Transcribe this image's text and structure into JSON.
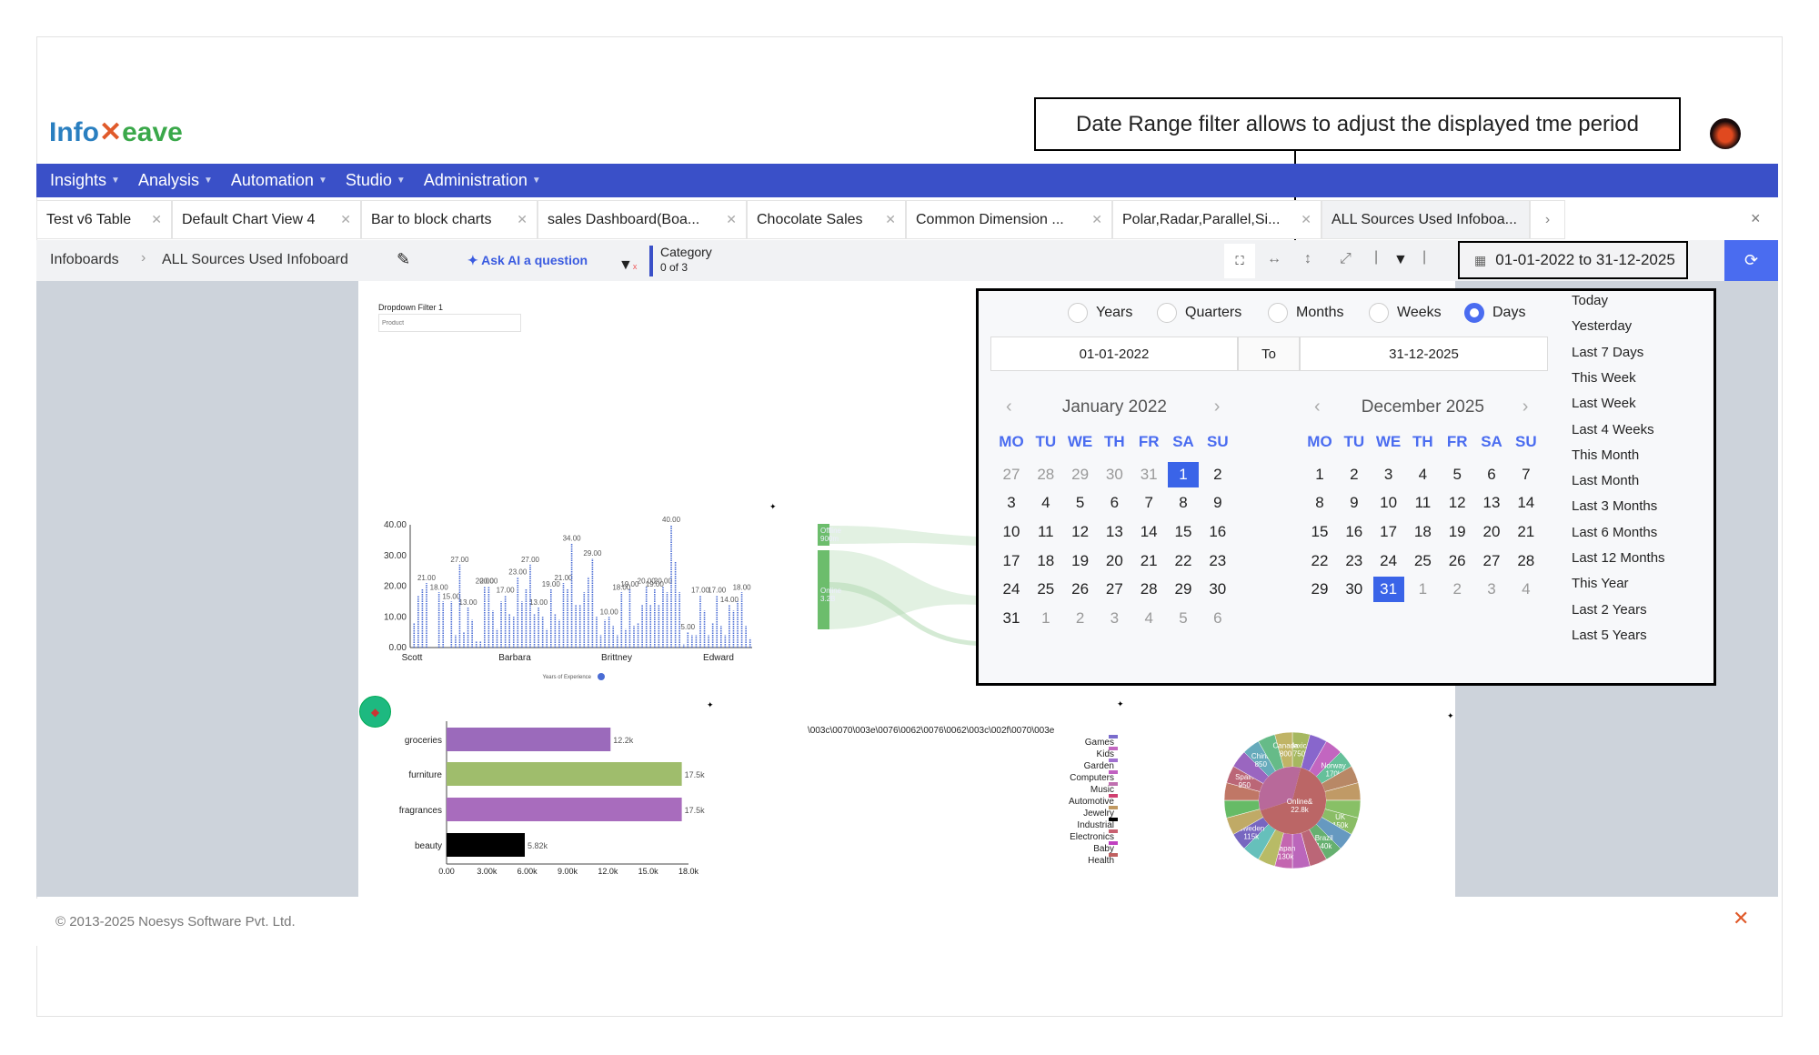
{
  "logo": {
    "part1": "Info",
    "part2": "eave"
  },
  "annotation": "Date Range filter allows to adjust the displayed tme period",
  "nav": [
    {
      "label": "Insights"
    },
    {
      "label": "Analysis"
    },
    {
      "label": "Automation"
    },
    {
      "label": "Studio"
    },
    {
      "label": "Administration"
    }
  ],
  "tabs": [
    {
      "label": "Test v6 Table"
    },
    {
      "label": "Default Chart View 4"
    },
    {
      "label": "Bar to block charts"
    },
    {
      "label": "sales Dashboard(Boa..."
    },
    {
      "label": "Chocolate Sales"
    },
    {
      "label": "Common Dimension ..."
    },
    {
      "label": "Polar,Radar,Parallel,Si..."
    },
    {
      "label": "ALL Sources Used Infoboa..."
    }
  ],
  "breadcrumb": {
    "root": "Infoboards",
    "current": "ALL Sources Used Infoboard"
  },
  "ask_ai": "Ask AI a question",
  "category_filter": {
    "label": "Category",
    "count": "0 of 3"
  },
  "date_range": {
    "value": "01-01-2022 to 31-12-2025"
  },
  "picker": {
    "modes": [
      "Years",
      "Quarters",
      "Months",
      "Weeks",
      "Days"
    ],
    "selected_mode": "Days",
    "from": "01-01-2022",
    "to_label": "To",
    "to": "31-12-2025",
    "weekdays": [
      "MO",
      "TU",
      "WE",
      "TH",
      "FR",
      "SA",
      "SU"
    ],
    "months": [
      {
        "title": "January 2022",
        "selected": 1,
        "weeks": [
          [
            27,
            28,
            29,
            30,
            31,
            1,
            2
          ],
          [
            3,
            4,
            5,
            6,
            7,
            8,
            9
          ],
          [
            10,
            11,
            12,
            13,
            14,
            15,
            16
          ],
          [
            17,
            18,
            19,
            20,
            21,
            22,
            23
          ],
          [
            24,
            25,
            26,
            27,
            28,
            29,
            30
          ],
          [
            31,
            1,
            2,
            3,
            4,
            5,
            6
          ]
        ]
      },
      {
        "title": "December 2025",
        "selected": 31,
        "weeks": [
          [
            1,
            2,
            3,
            4,
            5,
            6,
            7
          ],
          [
            8,
            9,
            10,
            11,
            12,
            13,
            14
          ],
          [
            15,
            16,
            17,
            18,
            19,
            20,
            21
          ],
          [
            22,
            23,
            24,
            25,
            26,
            27,
            28
          ],
          [
            29,
            30,
            31,
            1,
            2,
            3,
            4
          ]
        ]
      }
    ],
    "quick": [
      "Today",
      "Yesterday",
      "Last 7 Days",
      "This Week",
      "Last Week",
      "Last 4 Weeks",
      "This Month",
      "Last Month",
      "Last 3 Months",
      "Last 6 Months",
      "Last 12 Months",
      "This Year",
      "Last 2 Years",
      "Last 5 Years"
    ]
  },
  "dropdown_filter": {
    "label": "Dropdown Filter 1",
    "placeholder": "Product"
  },
  "chart_data": [
    {
      "type": "bar",
      "ylim": [
        0,
        40
      ],
      "yticks": [
        "0.00",
        "10.00",
        "20.00",
        "30.00",
        "40.00"
      ],
      "xticks": [
        "Scott",
        "Barbara",
        "Brittney",
        "Edward"
      ],
      "legend": "Years of Experience",
      "color": "#4a6cd4",
      "values": [
        8,
        17,
        19,
        21,
        0,
        0,
        18,
        15,
        0,
        15,
        4,
        27,
        5,
        13,
        9,
        2,
        2,
        20,
        20,
        12,
        6,
        15,
        17,
        11,
        10,
        23,
        15,
        19,
        27,
        11,
        13,
        10,
        6,
        19,
        11,
        9,
        21,
        19,
        34,
        14,
        14,
        18,
        23,
        29,
        10,
        4,
        9,
        10,
        7,
        4,
        18,
        6,
        19,
        7,
        8,
        14,
        20,
        14,
        19,
        14,
        20,
        18,
        40,
        28,
        18,
        1,
        5,
        4,
        4,
        17,
        12,
        4,
        8,
        17,
        7,
        4,
        14,
        12,
        15,
        18,
        7,
        3
      ]
    },
    {
      "type": "bar",
      "orientation": "horizontal",
      "categories": [
        "groceries",
        "furniture",
        "fragrances",
        "beauty"
      ],
      "values": [
        12200,
        17500,
        17500,
        5820
      ],
      "data_labels": [
        "12.2k",
        "17.5k",
        "17.5k",
        "5.82k"
      ],
      "colors": [
        "#9b6abb",
        "#9fbd6c",
        "#a86cbd",
        "#000000"
      ],
      "xlim": [
        0,
        18000
      ],
      "xticks": [
        "0.00",
        "3.00k",
        "6.00k",
        "9.00k",
        "12.0k",
        "15.0k",
        "18.0k"
      ]
    },
    {
      "type": "bar",
      "orientation": "horizontal",
      "title": "\\003c\\0070\\003e\\0076\\0062\\0076\\0062\\003c\\002f\\0070\\003e",
      "categories": [
        "Games",
        "Kids",
        "Garden",
        "Computers",
        "Music",
        "Automotive",
        "Jewelry",
        "Industrial",
        "Electronics",
        "Baby",
        "Health"
      ],
      "colors": [
        "#7a6ccc",
        "#c268c0",
        "#a070d0",
        "#c060c0",
        "#c070b0",
        "#d04070",
        "#c09860",
        "#000000",
        "#c86070",
        "#c040c0",
        "#c06060"
      ]
    },
    {
      "type": "sankey",
      "nodes": [
        {
          "label": "Offline",
          "value": "900m"
        },
        {
          "label": "Online",
          "value": "3.2B"
        }
      ],
      "color": "#6cbd6c"
    },
    {
      "type": "pie",
      "subtype": "sunburst",
      "inner": [
        {
          "label": "",
          "color": "#b8699a",
          "share": 0.34
        },
        {
          "label": "Online&",
          "value": "22.8k",
          "color": "#bb6666",
          "share": 0.66
        }
      ],
      "outer": [
        {
          "label": "Mexico",
          "value": "750",
          "color": "#a6b860"
        },
        {
          "label": "",
          "color": "#8866cc"
        },
        {
          "label": "",
          "color": "#c266c0"
        },
        {
          "label": "Norway",
          "value": "170k",
          "color": "#66c09a"
        },
        {
          "label": "",
          "color": "#b88866"
        },
        {
          "label": "",
          "color": "#c09a66"
        },
        {
          "label": "",
          "color": "#88c066"
        },
        {
          "label": "UK",
          "value": "150k",
          "color": "#8abd66"
        },
        {
          "label": "",
          "color": "#6699c0"
        },
        {
          "label": "Brazil",
          "value": "140k",
          "color": "#66b070"
        },
        {
          "label": "",
          "color": "#bb6677"
        },
        {
          "label": "",
          "color": "#bb66bb"
        },
        {
          "label": "Japan",
          "value": "130k",
          "color": "#c466b0"
        },
        {
          "label": "",
          "color": "#b8bb66"
        },
        {
          "label": "",
          "color": "#66c0bb"
        },
        {
          "label": "Sweden",
          "value": "115k",
          "color": "#7766c0"
        },
        {
          "label": "",
          "color": "#c0aa66"
        },
        {
          "label": "",
          "color": "#66bb66"
        },
        {
          "label": "",
          "color": "#c07766"
        },
        {
          "label": "Spain",
          "value": "950",
          "color": "#bb6677"
        },
        {
          "label": "",
          "color": "#9a66c0"
        },
        {
          "label": "China",
          "value": "850",
          "color": "#66aabb"
        },
        {
          "label": "",
          "color": "#66bb88"
        },
        {
          "label": "Canada",
          "value": "800",
          "color": "#c0b466"
        }
      ]
    }
  ],
  "footer": {
    "copyright": "© 2013-2025 Noesys Software Pvt. Ltd."
  }
}
